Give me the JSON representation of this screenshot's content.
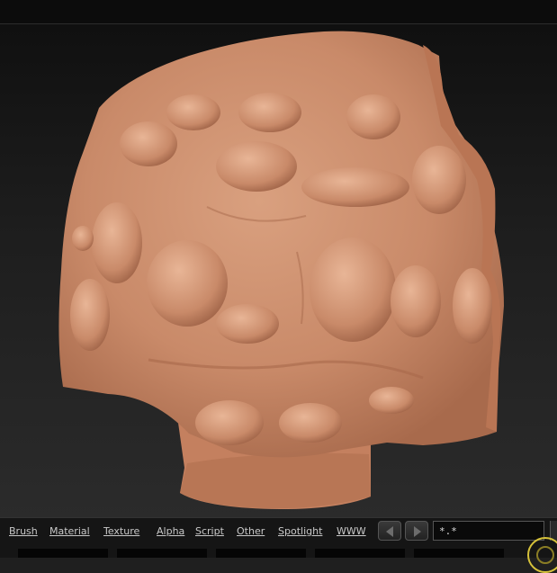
{
  "menu": {
    "items": [
      "Brush",
      "Material",
      "Texture",
      "Alpha",
      "Script",
      "Other",
      "Spotlight",
      "WWW"
    ]
  },
  "nav": {
    "prev_icon": "arrow-left-icon",
    "next_icon": "arrow-right-icon"
  },
  "filter": {
    "value": "*.*"
  },
  "canvas": {
    "object": "sculpted-clay-mesh",
    "material_color": "#c98a69"
  },
  "icons": {
    "rotate": "rotate-gizmo-icon"
  }
}
